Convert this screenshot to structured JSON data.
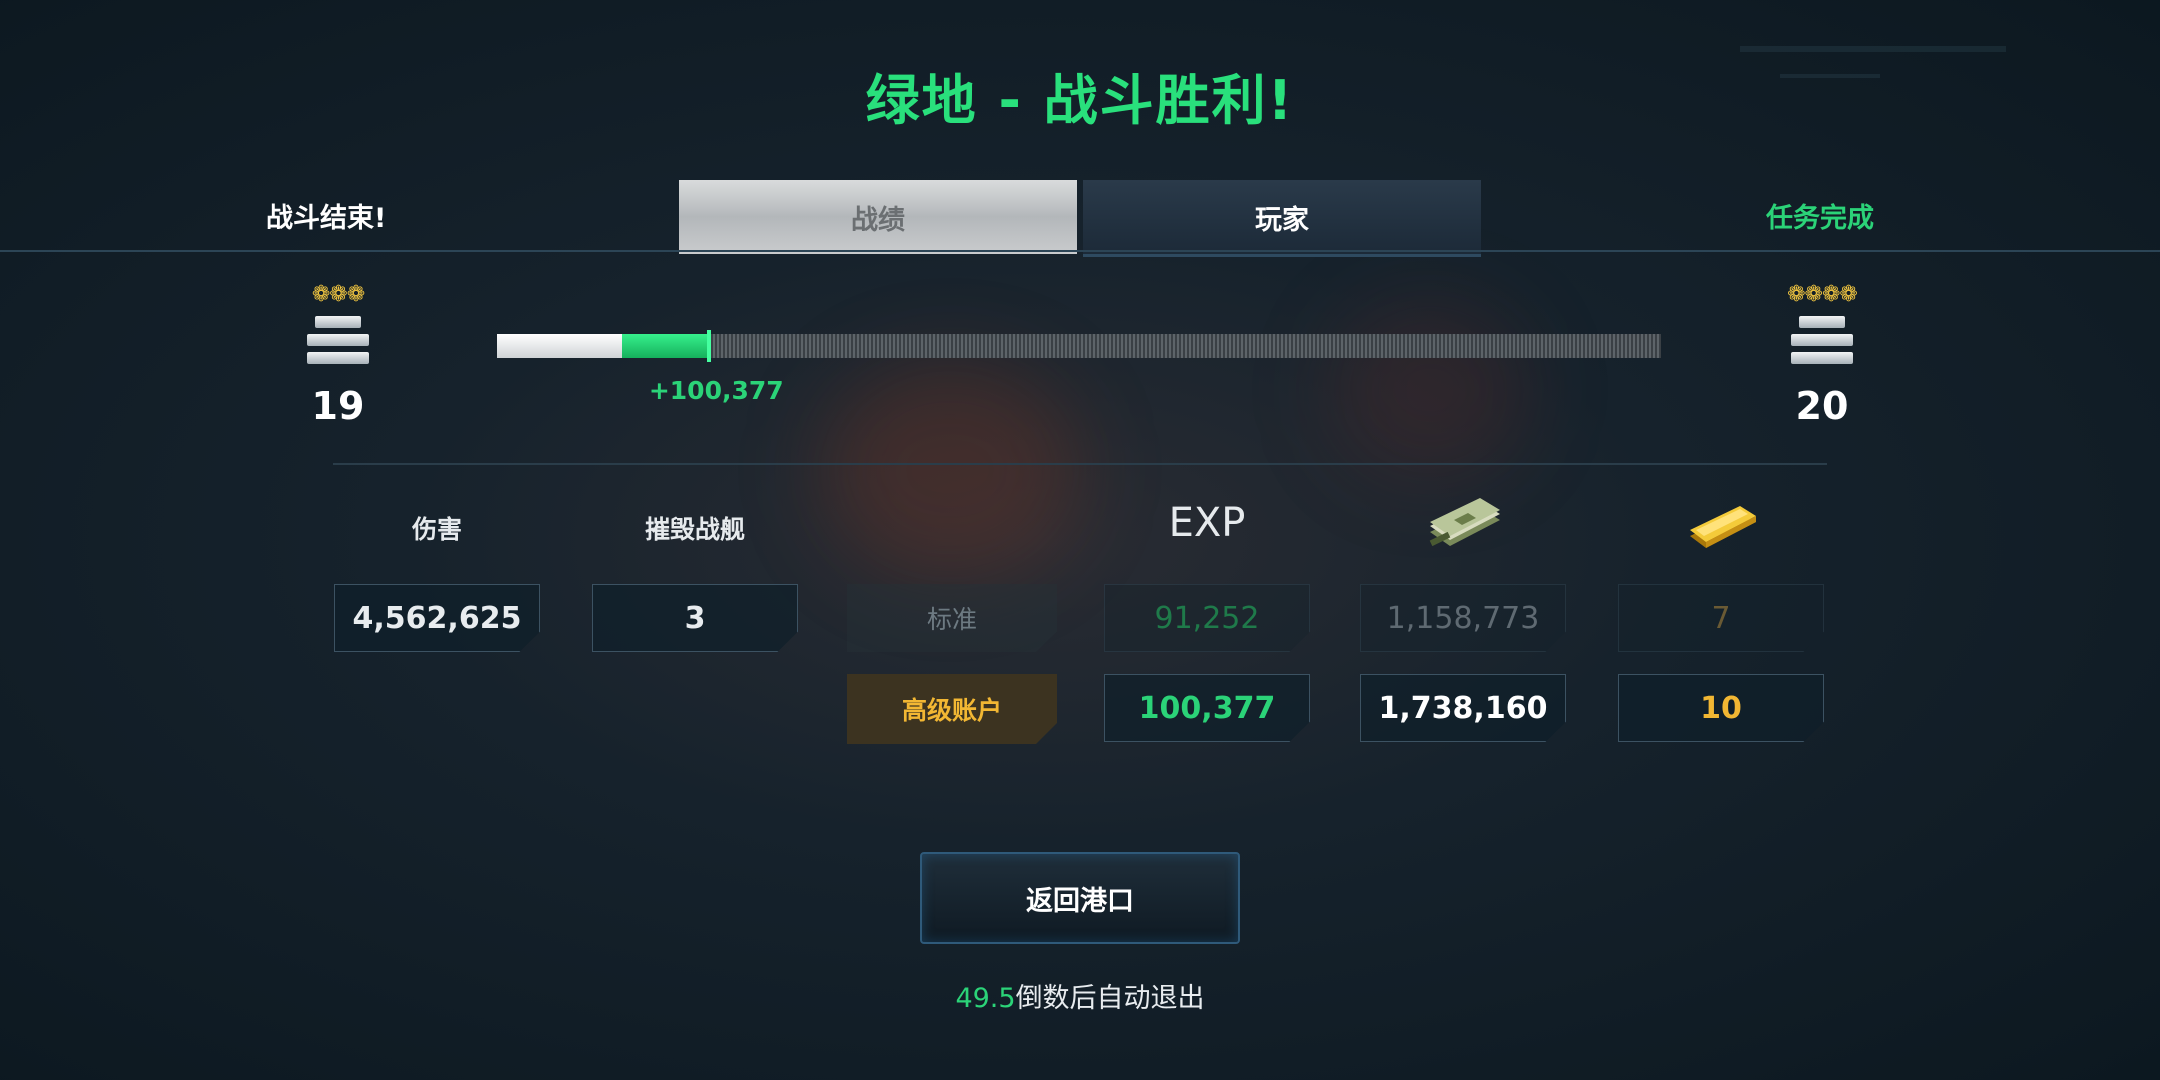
{
  "title": "绿地 - 战斗胜利!",
  "header": {
    "battle_over": "战斗结束!",
    "mission_complete": "任务完成"
  },
  "tabs": [
    {
      "label": "战绩",
      "active": true
    },
    {
      "label": "玩家",
      "active": false
    }
  ],
  "progress": {
    "current_rank": {
      "stars": "❁❁❁",
      "level": "19"
    },
    "next_rank": {
      "stars": "❁❁❁❁",
      "level": "20"
    },
    "bar_previous_fraction": 0.107,
    "bar_gained_fraction": 0.075,
    "xp_gained_label": "+100,377"
  },
  "stats": {
    "damage_label": "伤害",
    "damage_value": "4,562,625",
    "kills_label": "摧毁战舰",
    "kills_value": "3"
  },
  "rewards": {
    "exp_header": "EXP",
    "cash_icon": "cash-stack-icon",
    "gold_icon": "gold-bar-icon",
    "standard": {
      "label": "标准",
      "exp": "91,252",
      "cash": "1,158,773",
      "gold": "7"
    },
    "premium": {
      "label": "高级账户",
      "exp": "100,377",
      "cash": "1,738,160",
      "gold": "10"
    }
  },
  "return_button": "返回港口",
  "countdown": {
    "seconds": "49.5",
    "text": "倒数后自动退出"
  },
  "colors": {
    "accent_green": "#29e07c",
    "premium_gold": "#f2b733",
    "background": "#0c1820"
  }
}
